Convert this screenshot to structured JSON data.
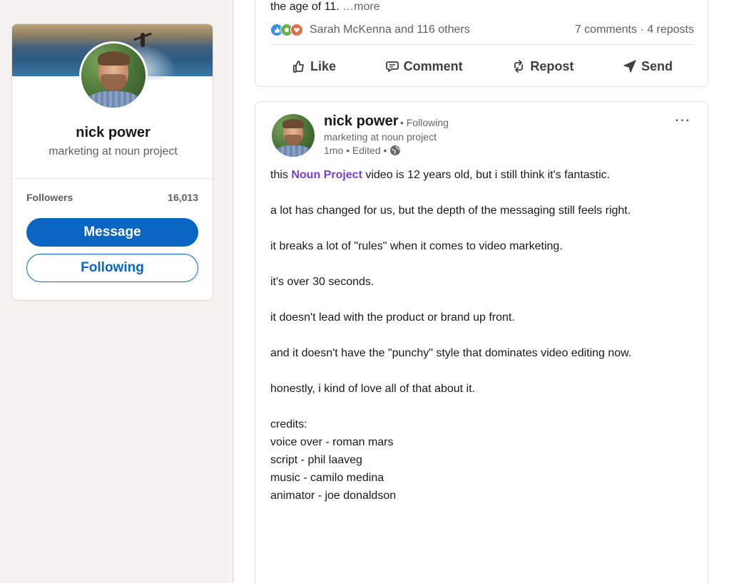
{
  "profile": {
    "name": "nick power",
    "headline": "marketing at noun project",
    "followers_label": "Followers",
    "followers_count": "16,013",
    "message_label": "Message",
    "following_label": "Following"
  },
  "previous_post": {
    "truncated_text": "the age of 11.",
    "more_label": "…more",
    "reactions_text": "Sarah McKenna and 116 others",
    "stats_text": "7 comments · 4 reposts",
    "actions": [
      {
        "label": "Like",
        "icon": "thumbs-up-icon"
      },
      {
        "label": "Comment",
        "icon": "comment-icon"
      },
      {
        "label": "Repost",
        "icon": "repost-icon"
      },
      {
        "label": "Send",
        "icon": "send-icon"
      }
    ]
  },
  "post": {
    "author_name": "nick power",
    "follow_status": "• Following",
    "author_headline": "marketing at noun project",
    "meta": "1mo • Edited •",
    "body_intro_prefix": "this ",
    "mention": "Noun Project",
    "body_intro_suffix": " video is 12 years old, but i still think it's fantastic.",
    "paragraphs": [
      "a lot has changed for us, but the depth of the messaging still feels right.",
      "it breaks a lot of \"rules\" when it comes to video marketing.",
      "it's over 30 seconds.",
      "it doesn't lead with the product or brand up front.",
      "and it doesn't have the \"punchy\" style that dominates video editing now.",
      "honestly, i kind of love all of that about it."
    ],
    "credits": [
      "credits:",
      "voice over - roman mars",
      "script - phil laaveg",
      "music - camilo medina",
      "animator - joe donaldson"
    ]
  },
  "colors": {
    "brand_blue": "#0a66c2",
    "mention_purple": "#7a3fd0"
  }
}
